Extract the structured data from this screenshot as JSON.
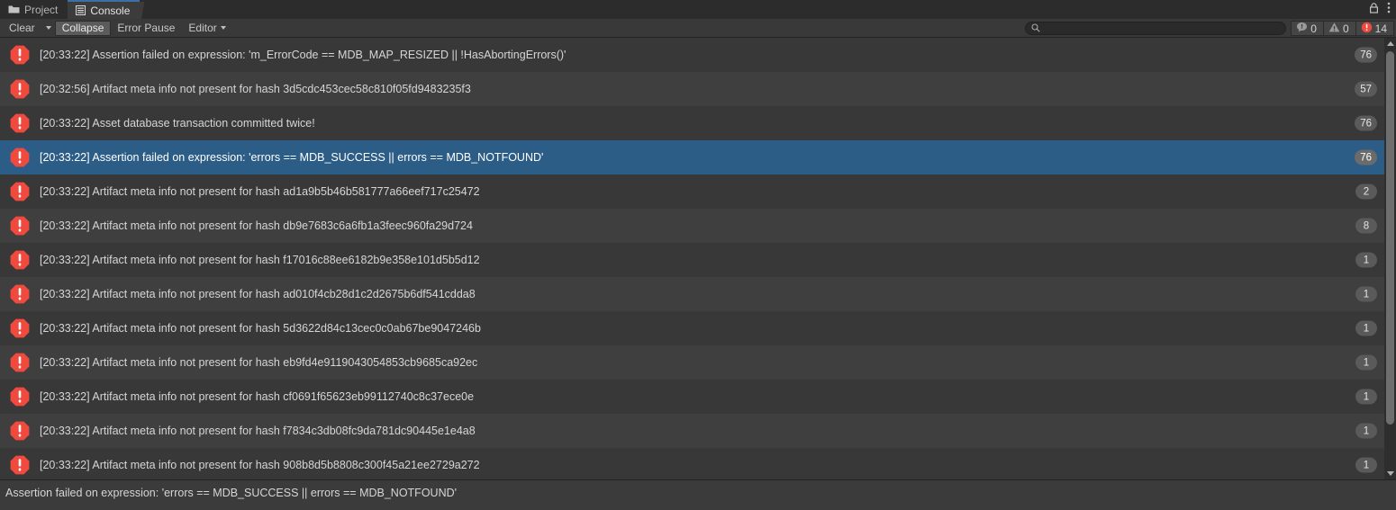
{
  "window": {
    "tabs": [
      {
        "label": "Project",
        "icon": "folder-icon",
        "active": false
      },
      {
        "label": "Console",
        "icon": "console-icon",
        "active": true
      }
    ],
    "controls": [
      {
        "name": "lock-icon"
      },
      {
        "name": "more-menu-icon"
      }
    ]
  },
  "toolbar": {
    "clear_label": "Clear",
    "clear_dropdown_icon": "chevron-down-icon",
    "collapse_label": "Collapse",
    "collapse_active": true,
    "error_pause_label": "Error Pause",
    "editor_label": "Editor",
    "editor_dropdown_icon": "chevron-down-icon",
    "search": {
      "icon": "search-icon",
      "value": "",
      "placeholder": ""
    },
    "counters": [
      {
        "name": "info-counter",
        "icon": "info-bubble-icon",
        "count": "0",
        "color": "#9a9a9a"
      },
      {
        "name": "warning-counter",
        "icon": "warning-triangle-icon",
        "count": "0",
        "color": "#9a9a9a"
      },
      {
        "name": "error-counter",
        "icon": "error-octagon-icon",
        "count": "14",
        "color": "#f04a3f"
      }
    ]
  },
  "colors": {
    "selection": "#2c5d87",
    "error_red": "#f04a3f",
    "tab_accent": "#3e6ea8",
    "row_even": "#383838",
    "row_odd": "#3f3f3f"
  },
  "log": {
    "entries": [
      {
        "icon": "error-octagon-icon",
        "message": "[20:33:22] Assertion failed on expression: 'm_ErrorCode == MDB_MAP_RESIZED || !HasAbortingErrors()'",
        "count": "76",
        "selected": false
      },
      {
        "icon": "error-octagon-icon",
        "message": "[20:32:56] Artifact meta info not present for hash 3d5cdc453cec58c810f05fd9483235f3",
        "count": "57",
        "selected": false
      },
      {
        "icon": "error-octagon-icon",
        "message": "[20:33:22] Asset database transaction committed twice!",
        "count": "76",
        "selected": false
      },
      {
        "icon": "error-octagon-icon",
        "message": "[20:33:22] Assertion failed on expression: 'errors == MDB_SUCCESS || errors == MDB_NOTFOUND'",
        "count": "76",
        "selected": true
      },
      {
        "icon": "error-octagon-icon",
        "message": "[20:33:22] Artifact meta info not present for hash ad1a9b5b46b581777a66eef717c25472",
        "count": "2",
        "selected": false
      },
      {
        "icon": "error-octagon-icon",
        "message": "[20:33:22] Artifact meta info not present for hash db9e7683c6a6fb1a3feec960fa29d724",
        "count": "8",
        "selected": false
      },
      {
        "icon": "error-octagon-icon",
        "message": "[20:33:22] Artifact meta info not present for hash f17016c88ee6182b9e358e101d5b5d12",
        "count": "1",
        "selected": false
      },
      {
        "icon": "error-octagon-icon",
        "message": "[20:33:22] Artifact meta info not present for hash ad010f4cb28d1c2d2675b6df541cdda8",
        "count": "1",
        "selected": false
      },
      {
        "icon": "error-octagon-icon",
        "message": "[20:33:22] Artifact meta info not present for hash 5d3622d84c13cec0c0ab67be9047246b",
        "count": "1",
        "selected": false
      },
      {
        "icon": "error-octagon-icon",
        "message": "[20:33:22] Artifact meta info not present for hash eb9fd4e9119043054853cb9685ca92ec",
        "count": "1",
        "selected": false
      },
      {
        "icon": "error-octagon-icon",
        "message": "[20:33:22] Artifact meta info not present for hash cf0691f65623eb99112740c8c37ece0e",
        "count": "1",
        "selected": false
      },
      {
        "icon": "error-octagon-icon",
        "message": "[20:33:22] Artifact meta info not present for hash f7834c3db08fc9da781dc90445e1e4a8",
        "count": "1",
        "selected": false
      },
      {
        "icon": "error-octagon-icon",
        "message": "[20:33:22] Artifact meta info not present for hash 908b8d5b8808c300f45a21ee2729a272",
        "count": "1",
        "selected": false
      }
    ]
  },
  "detail": {
    "text": "Assertion failed on expression: 'errors == MDB_SUCCESS || errors == MDB_NOTFOUND'"
  },
  "scrollbar": {
    "up_icon": "arrow-up-icon",
    "down_icon": "arrow-down-icon"
  }
}
